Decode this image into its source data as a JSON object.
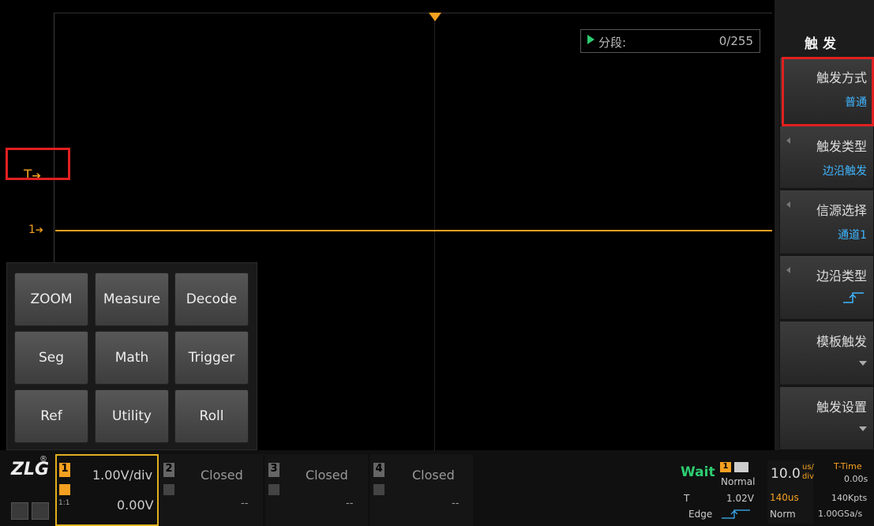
{
  "scope": {
    "segment_label": "分段:",
    "segment_value": "0/255",
    "trigger_marker": "T",
    "ch1_marker": "1"
  },
  "quick_panel": {
    "buttons": [
      "ZOOM",
      "Measure",
      "Decode",
      "Seg",
      "Math",
      "Trigger",
      "Ref",
      "Utility",
      "Roll"
    ]
  },
  "menu": {
    "title": "触发",
    "items": [
      {
        "label": "触发方式",
        "value": "普通"
      },
      {
        "label": "触发类型",
        "value": "边沿触发"
      },
      {
        "label": "信源选择",
        "value": "通道1"
      },
      {
        "label": "边沿类型",
        "value": ""
      },
      {
        "label": "模板触发",
        "value": ""
      },
      {
        "label": "触发设置",
        "value": ""
      }
    ]
  },
  "status": {
    "logo": "ZLG",
    "logo_mark": "®",
    "ch1": {
      "num": "1",
      "scale": "1.00V/div",
      "offset": "0.00V",
      "probe": "1:1"
    },
    "ch2": {
      "num": "2",
      "state": "Closed",
      "offset": "--"
    },
    "ch3": {
      "num": "3",
      "state": "Closed",
      "offset": "--"
    },
    "ch4": {
      "num": "4",
      "state": "Closed",
      "offset": "--"
    },
    "trigger": {
      "status": "Wait",
      "source_num": "1",
      "mode": "Normal",
      "level_label": "T",
      "level": "1.02V",
      "type": "Edge"
    },
    "timebase": {
      "scale": "10.0",
      "unit_top": "us/",
      "unit_bottom": "div",
      "delay": "140us",
      "acq_mode": "Norm"
    },
    "time": {
      "label": "T-Time",
      "value": "0.00s",
      "points": "140Kpts",
      "rate": "1.00GSa/s"
    }
  },
  "colors": {
    "ch1": "#f5a020",
    "highlight": "#e02020",
    "value_blue": "#3fb6ff",
    "play_green": "#2ecc71"
  }
}
